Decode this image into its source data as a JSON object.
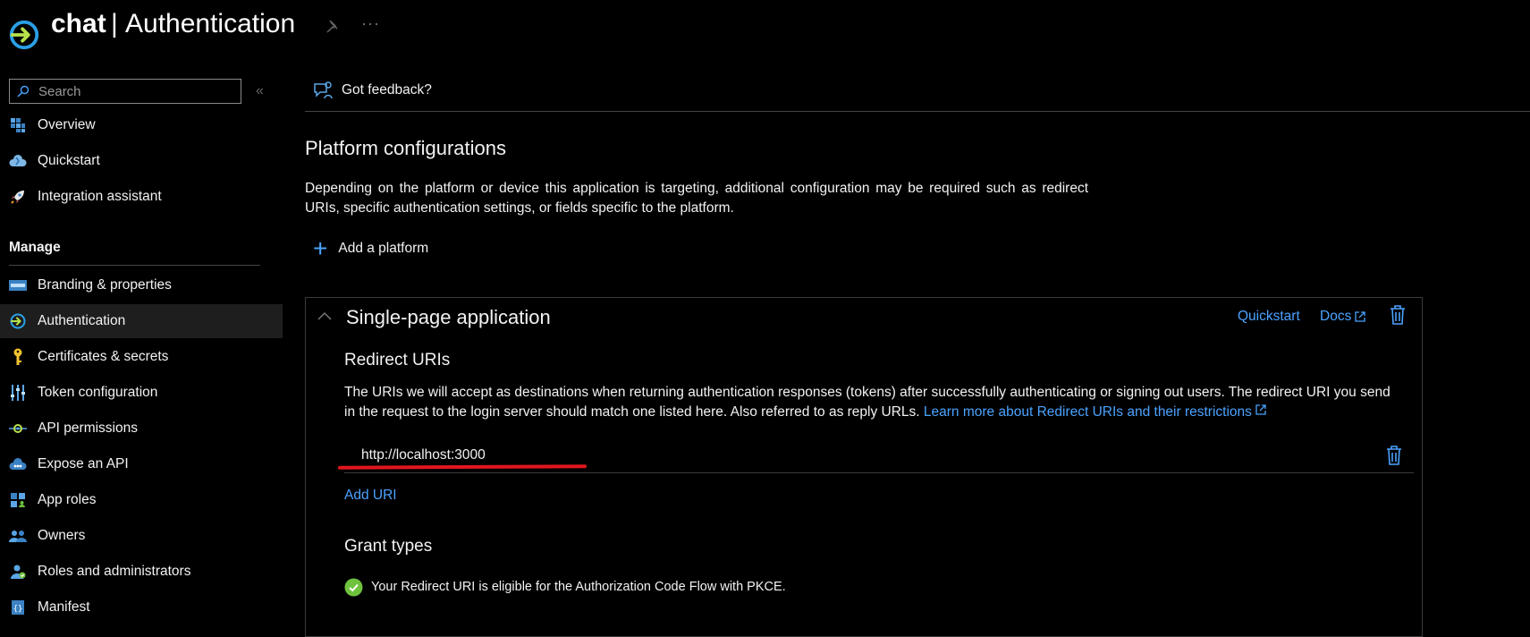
{
  "header": {
    "app_name": "chat",
    "separator": "|",
    "page_title": "Authentication",
    "more": "···"
  },
  "sidebar": {
    "search_placeholder": "Search",
    "collapse": "«",
    "manage_label": "Manage",
    "items": [
      {
        "label": "Overview",
        "icon": "grid-icon"
      },
      {
        "label": "Quickstart",
        "icon": "cloud-icon"
      },
      {
        "label": "Integration assistant",
        "icon": "rocket-icon"
      },
      {
        "label": "Branding & properties",
        "icon": "branding-icon"
      },
      {
        "label": "Authentication",
        "icon": "authentication-icon"
      },
      {
        "label": "Certificates & secrets",
        "icon": "key-icon"
      },
      {
        "label": "Token configuration",
        "icon": "sliders-icon"
      },
      {
        "label": "API permissions",
        "icon": "api-icon"
      },
      {
        "label": "Expose an API",
        "icon": "cloud-api-icon"
      },
      {
        "label": "App roles",
        "icon": "app-roles-icon"
      },
      {
        "label": "Owners",
        "icon": "users-icon"
      },
      {
        "label": "Roles and administrators",
        "icon": "admin-icon"
      },
      {
        "label": "Manifest",
        "icon": "manifest-icon"
      }
    ]
  },
  "main": {
    "feedback_label": "Got feedback?",
    "section_title": "Platform configurations",
    "section_description": "Depending on the platform or device this application is targeting, additional configuration may be required such as redirect URIs, specific authentication settings, or fields specific to the platform.",
    "add_platform_label": "Add a platform",
    "platform": {
      "title": "Single-page application",
      "quickstart_label": "Quickstart",
      "docs_label": "Docs",
      "redirect_title": "Redirect URIs",
      "redirect_description": "The URIs we will accept as destinations when returning authentication responses (tokens) after successfully authenticating or signing out users. The redirect URI you send in the request to the login server should match one listed here. Also referred to as reply URLs. ",
      "redirect_link": "Learn more about Redirect URIs and their restrictions",
      "uri_value": "http://localhost:3000",
      "add_uri_label": "Add URI",
      "grant_title": "Grant types",
      "grant_text": "Your Redirect URI is eligible for the Authorization Code Flow with PKCE."
    }
  },
  "colors": {
    "accent": "#4aa3ff",
    "annotation": "#e0161d",
    "success": "#6fc23e"
  }
}
